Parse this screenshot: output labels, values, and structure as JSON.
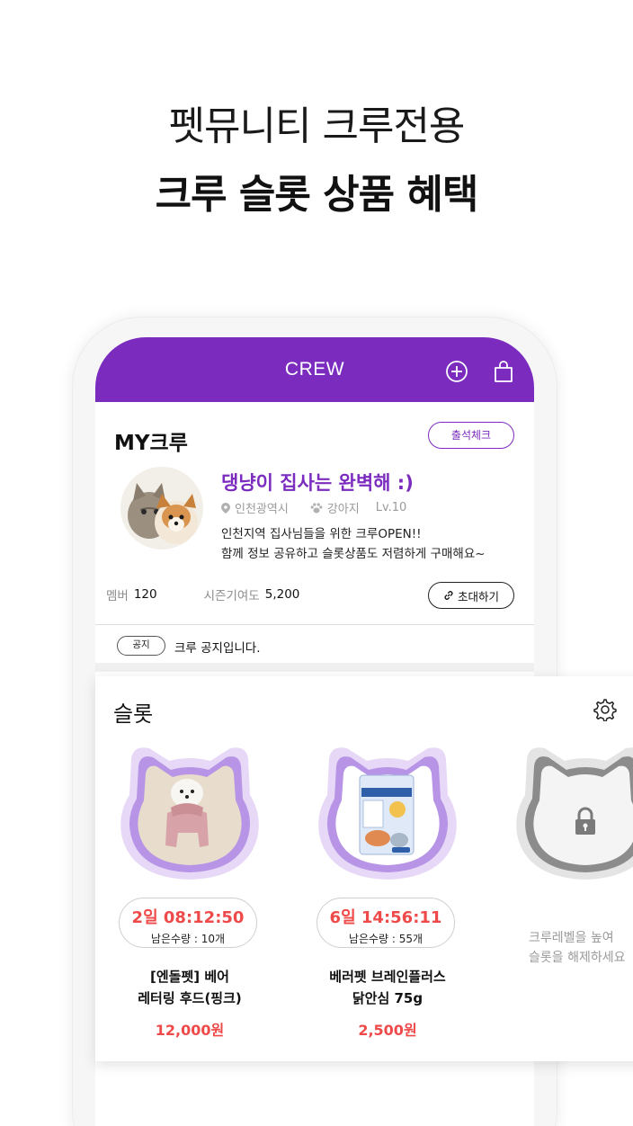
{
  "promo": {
    "headline_line1": "펫뮤니티 크루전용",
    "headline_line2": "크루 슬롯 상품 혜택"
  },
  "appbar": {
    "title": "CREW",
    "icons": [
      "add-circle-icon",
      "shopping-bag-icon"
    ],
    "color": "#7b2cbf"
  },
  "my_crew": {
    "heading": "MY크루",
    "checkin_label": "출석체크",
    "crew_name": "댕냥이 집사는 완벽해 :)",
    "location": "인천광역시",
    "pet_type": "강아지",
    "level": "Lv.10",
    "description_line1": "인천지역 집사님들을 위한 크루OPEN!!",
    "description_line2": "함께 정보 공유하고 슬롯상품도 저렴하게 구매해요~",
    "member_label": "멤버",
    "member_count": "120",
    "contribution_label": "시즌기여도",
    "contribution_value": "5,200",
    "invite_label": "초대하기",
    "notice_badge": "공지",
    "notice_text": "크루 공지입니다."
  },
  "slots": {
    "title": "슬롯",
    "items": [
      {
        "timer": "2일 08:12:50",
        "remaining": "남은수량 : 10개",
        "name_line1": "[엔돌펫] 베어",
        "name_line2": "레터링 후드(핑크)",
        "price": "12,000원"
      },
      {
        "timer": "6일 14:56:11",
        "remaining": "남은수량 : 55개",
        "name_line1": "베러펫 브레인플러스",
        "name_line2": "닭안심 75g",
        "price": "2,500원"
      }
    ],
    "locked_line1": "크루레벨을 높여",
    "locked_line2": "슬롯을 해제하세요",
    "accent_red": "#ef4a4a",
    "frame_purple": "#b794e6"
  }
}
